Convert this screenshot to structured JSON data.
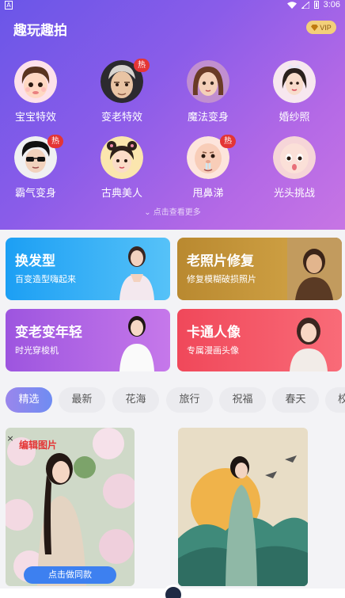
{
  "status": {
    "left_icon_letter": "A",
    "time": "3:06"
  },
  "header": {
    "title": "趣玩趣拍",
    "vip_label": "VIP"
  },
  "features": [
    {
      "label": "宝宝特效",
      "hot": false
    },
    {
      "label": "变老特效",
      "hot": true
    },
    {
      "label": "魔法变身",
      "hot": false
    },
    {
      "label": "婚纱照",
      "hot": false
    },
    {
      "label": "霸气变身",
      "hot": true
    },
    {
      "label": "古典美人",
      "hot": false
    },
    {
      "label": "甩鼻涕",
      "hot": true
    },
    {
      "label": "光头挑战",
      "hot": false
    }
  ],
  "hot_label": "热",
  "more_label": "点击查看更多",
  "cards": [
    {
      "title": "换发型",
      "subtitle": "百变造型嗨起来",
      "color_from": "#1c9ff4",
      "color_to": "#56c2f8"
    },
    {
      "title": "老照片修复",
      "subtitle": "修复模糊破损照片",
      "color_from": "#b98930",
      "color_to": "#d6a84a"
    },
    {
      "title": "变老变年轻",
      "subtitle": "时光穿梭机",
      "color_from": "#9d55df",
      "color_to": "#c678ea"
    },
    {
      "title": "卡通人像",
      "subtitle": "专属漫画头像",
      "color_from": "#f0485a",
      "color_to": "#f96b78"
    }
  ],
  "tabs": [
    "精选",
    "最新",
    "花海",
    "旅行",
    "祝福",
    "春天",
    "校"
  ],
  "feed": {
    "edit_label": "编辑图片",
    "close_label": "×",
    "do_same_label": "点击做同款"
  }
}
